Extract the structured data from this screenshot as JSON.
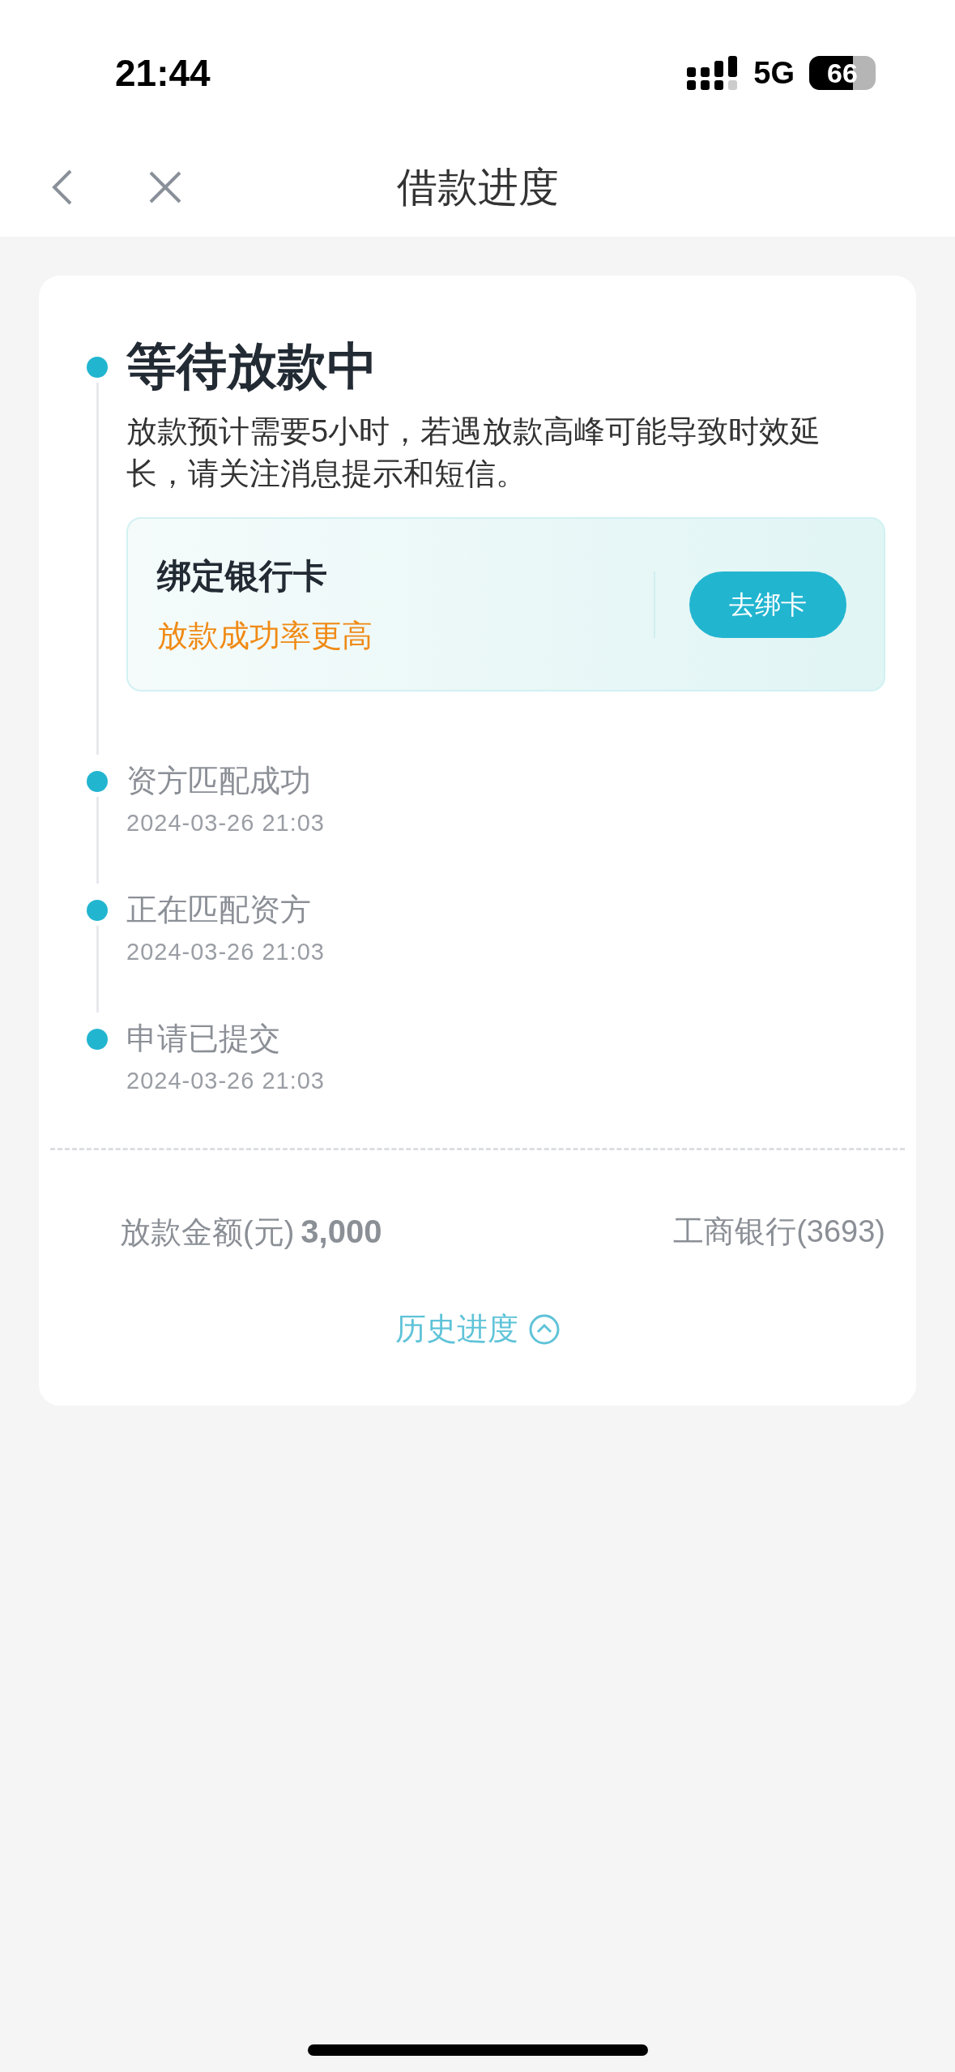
{
  "status_bar": {
    "time": "21:44",
    "network": "5G",
    "battery": "66"
  },
  "nav": {
    "title": "借款进度"
  },
  "current_step": {
    "title": "等待放款中",
    "description": "放款预计需要5小时，若遇放款高峰可能导致时效延长，请关注消息提示和短信。",
    "prompt": {
      "title": "绑定银行卡",
      "subtitle": "放款成功率更高",
      "button": "去绑卡"
    }
  },
  "steps": [
    {
      "title": "资方匹配成功",
      "time": "2024-03-26 21:03"
    },
    {
      "title": "正在匹配资方",
      "time": "2024-03-26 21:03"
    },
    {
      "title": "申请已提交",
      "time": "2024-03-26 21:03"
    }
  ],
  "summary": {
    "amount_label": "放款金额(元)",
    "amount": "3,000",
    "bank": "工商银行(3693)"
  },
  "history_link": {
    "label": "历史进度",
    "expanded": true
  }
}
